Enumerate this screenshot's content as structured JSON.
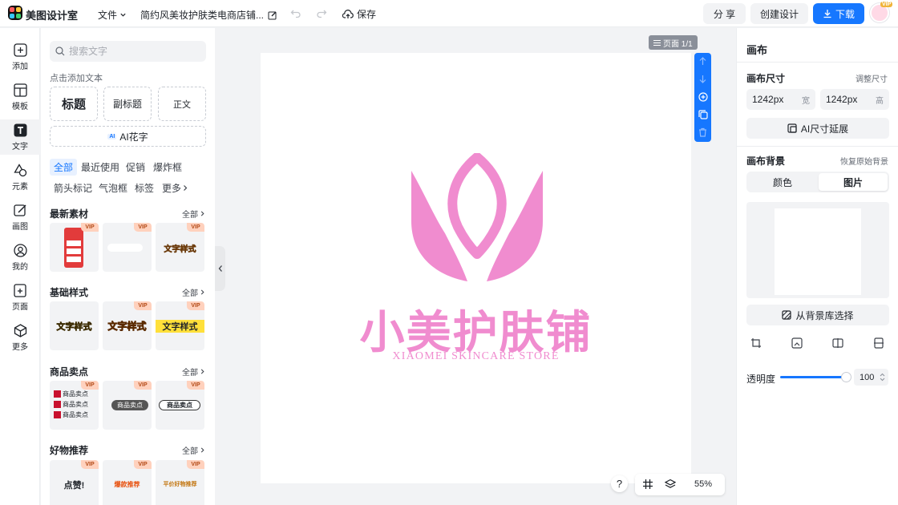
{
  "colors": {
    "accent": "#1677ff",
    "logo_pink": "#f08ccf",
    "vip_bg": "#ffd1bd"
  },
  "header": {
    "app_name": "美图设计室",
    "file_menu": "文件",
    "doc_title": "简约风美妆护肤类电商店铺...",
    "save": "保存",
    "share": "分 享",
    "create": "创建设计",
    "download": "下载",
    "vip": "VIP"
  },
  "rail": [
    {
      "label": "添加",
      "icon": "plus-square-icon"
    },
    {
      "label": "模板",
      "icon": "template-icon"
    },
    {
      "label": "文字",
      "icon": "text-icon"
    },
    {
      "label": "元素",
      "icon": "shapes-icon"
    },
    {
      "label": "画图",
      "icon": "draw-icon"
    },
    {
      "label": "我的",
      "icon": "user-icon"
    },
    {
      "label": "页面",
      "icon": "page-add-icon"
    },
    {
      "label": "更多",
      "icon": "cube-icon"
    }
  ],
  "panel": {
    "search_placeholder": "搜索文字",
    "click_add": "点击添加文本",
    "title_btn": "标题",
    "subtitle_btn": "副标题",
    "body_btn": "正文",
    "ai_chip": "AI",
    "ai_flower": "AI花字",
    "tags": [
      "全部",
      "最近使用",
      "促销",
      "爆炸框",
      "箭头标记",
      "气泡框",
      "标签",
      "更多"
    ],
    "all_link": "全部",
    "vip": "VIP",
    "sections": [
      {
        "title": "最新素材",
        "thumbs": [
          "",
          "",
          "文字样式"
        ]
      },
      {
        "title": "基础样式",
        "thumbs": [
          "文字样式",
          "文字样式",
          "文字样式"
        ]
      },
      {
        "title": "商品卖点",
        "thumbs": [
          "商品卖点",
          "商品卖点",
          "商品卖点"
        ]
      },
      {
        "title": "好物推荐",
        "thumbs": [
          "点赞!",
          "爆款推荐",
          "平价好物推荐"
        ]
      }
    ]
  },
  "canvas": {
    "page_indicator": "页面 1/1",
    "logo_cn": "小美护肤铺",
    "logo_en": "XIAOMEI SKINCARE STORE",
    "help": "?",
    "zoom": "55%"
  },
  "right": {
    "title": "画布",
    "size_label": "画布尺寸",
    "adjust_size": "调整尺寸",
    "width_value": "1242px",
    "width_unit": "宽",
    "height_value": "1242px",
    "height_unit": "高",
    "ai_extend": "AI尺寸延展",
    "bg_label": "画布背景",
    "restore_bg": "恢复原始背景",
    "seg_color": "颜色",
    "seg_image": "图片",
    "choose_bg": "从背景库选择",
    "opacity_label": "透明度",
    "opacity_value": "100"
  }
}
